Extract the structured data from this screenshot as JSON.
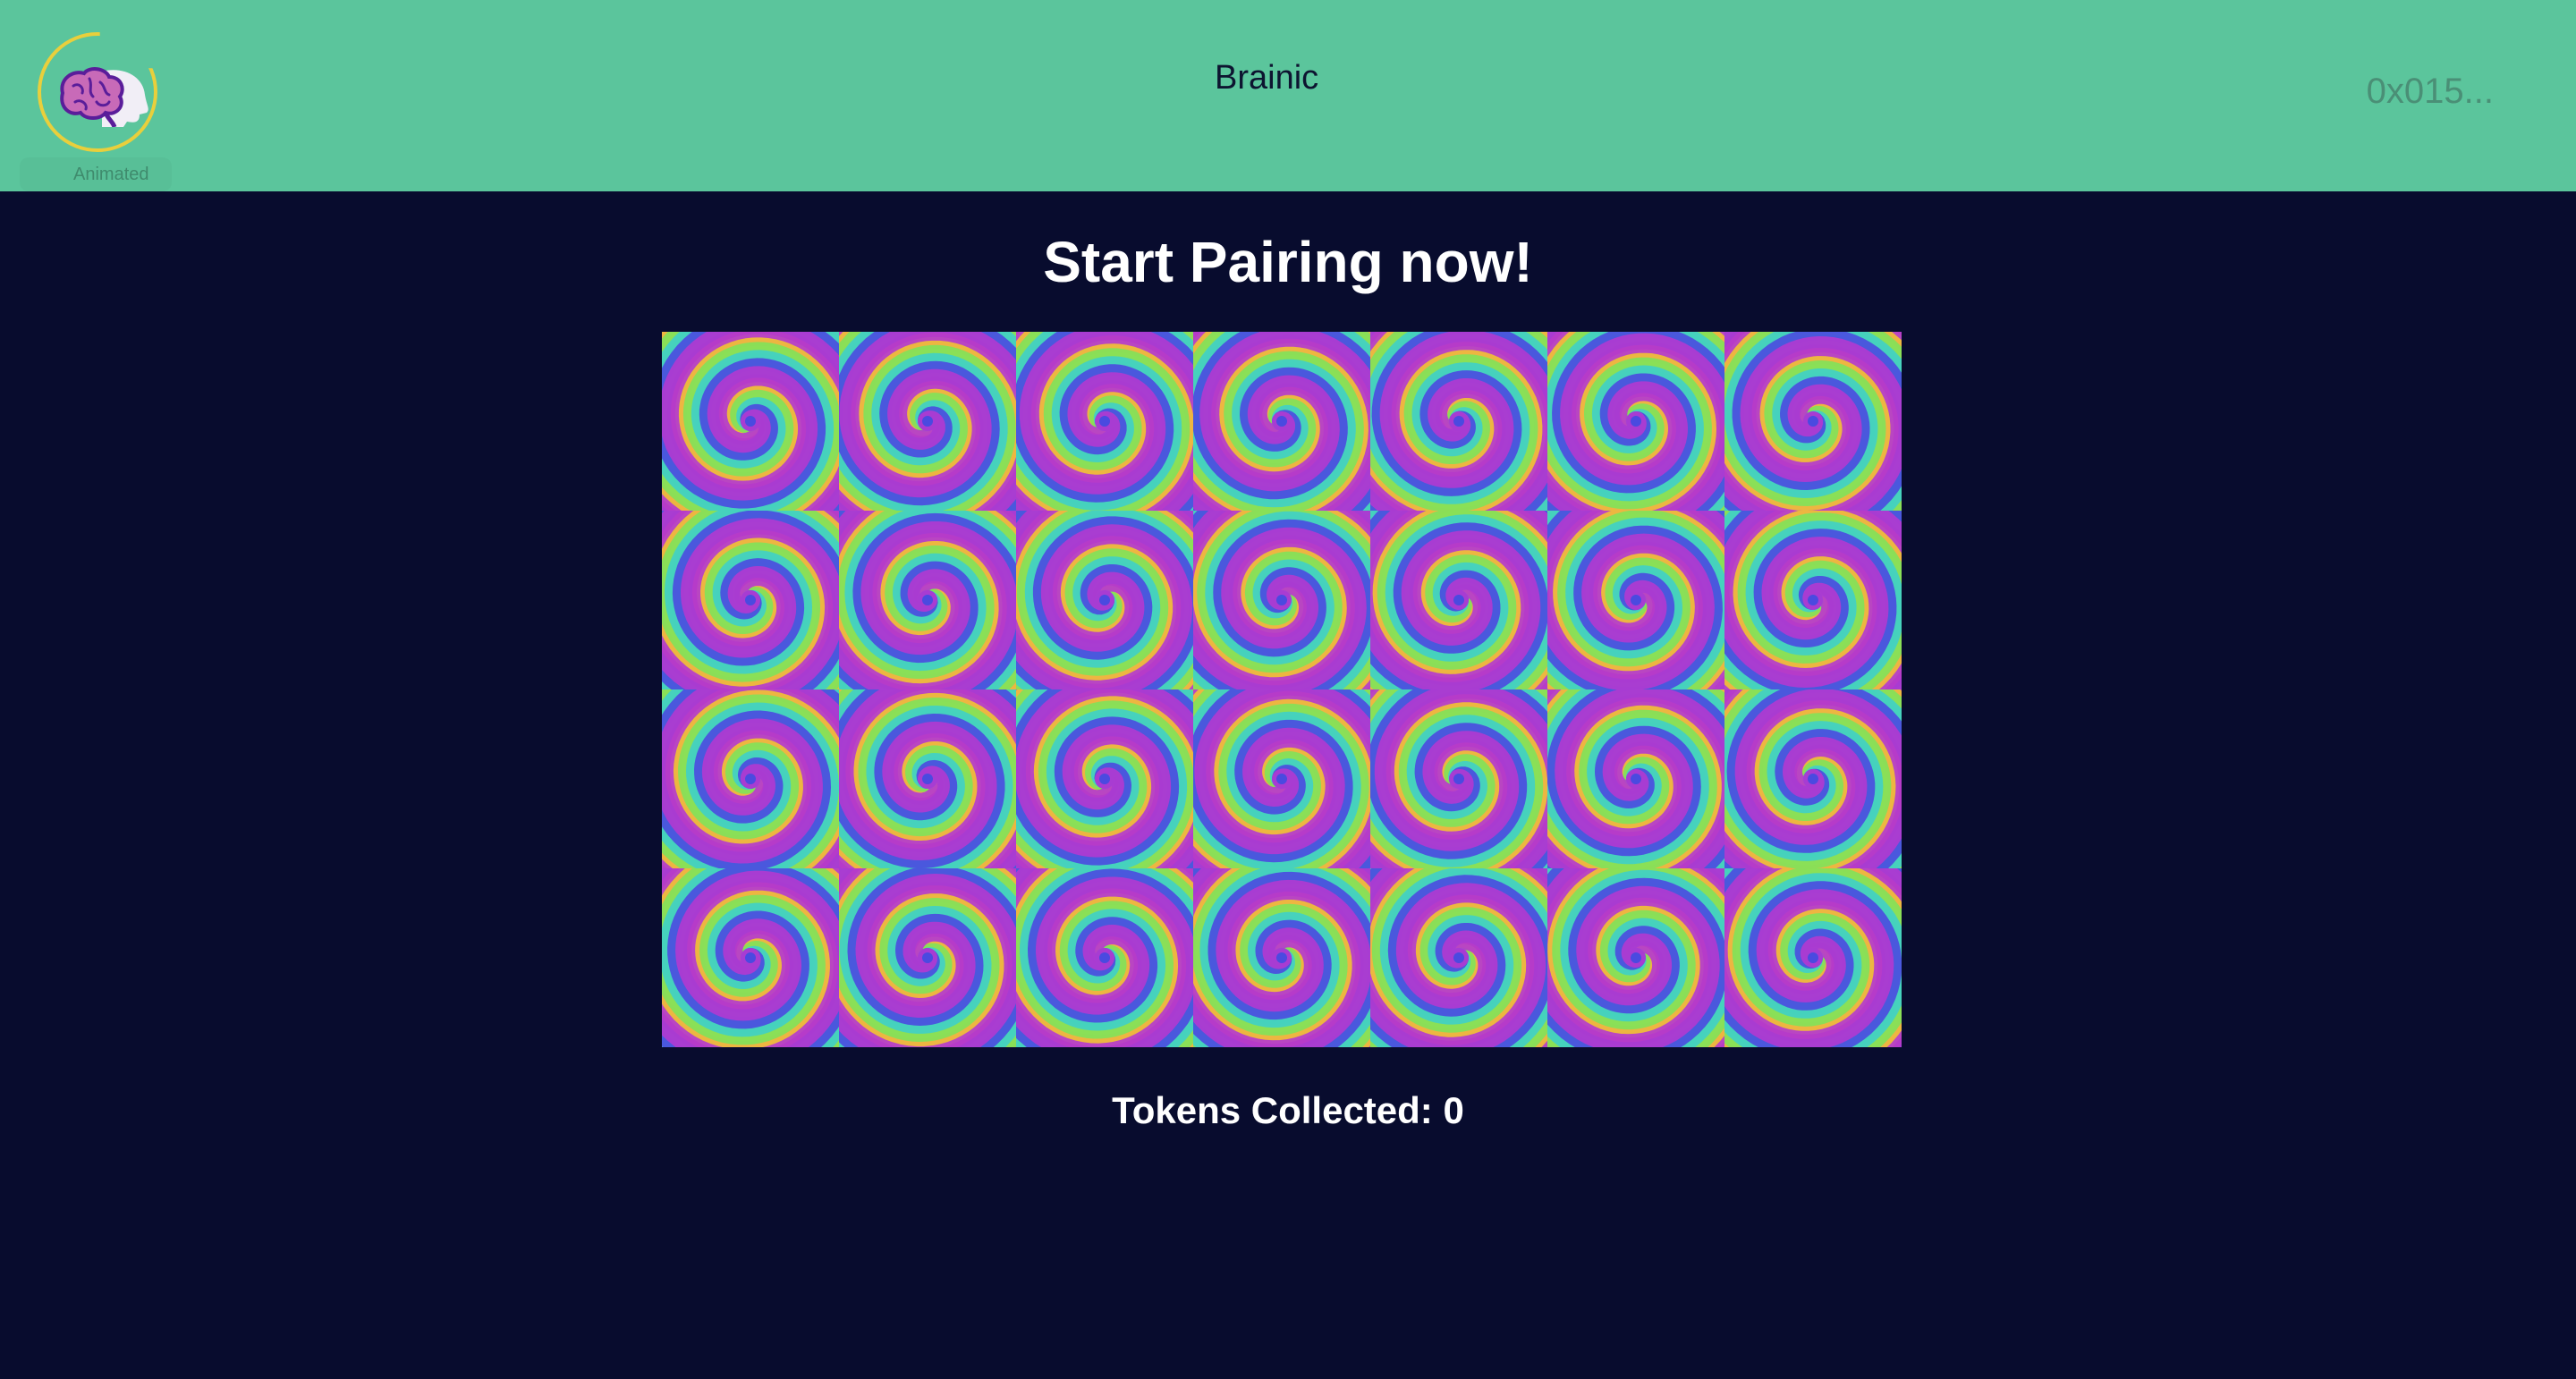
{
  "header": {
    "logo_caption": "Animated",
    "app_title": "Brainic",
    "wallet_address": "0x015..."
  },
  "game": {
    "heading": "Start Pairing now!",
    "tokens_label": "Tokens Collected: 0",
    "grid": {
      "rows": 4,
      "columns": 7
    },
    "card_face": "rainbow-spiral"
  },
  "colors": {
    "navbar": "#5bc59c",
    "background": "#080c2e",
    "logo_ring": "#e9cf3c"
  }
}
